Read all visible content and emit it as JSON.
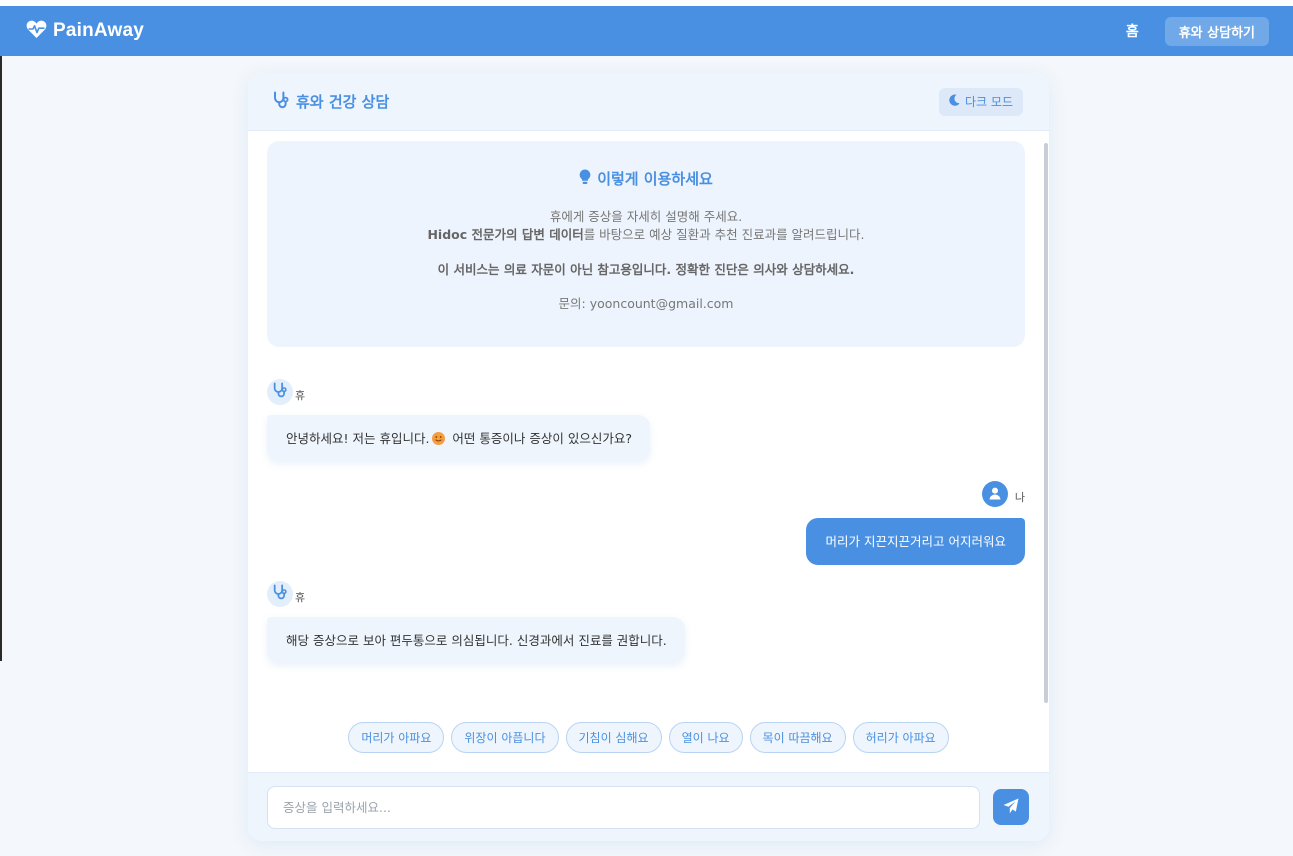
{
  "app": {
    "name": "PainAway",
    "brand_color": "#4a90e2"
  },
  "nav": {
    "home": "홈",
    "consult": "휴와 상담하기"
  },
  "chat": {
    "title": "휴와 건강 상담",
    "dark_mode_label": "다크 모드",
    "guide": {
      "title": "이렇게 이용하세요",
      "line1": "휴에게 증상을 자세히 설명해 주세요.",
      "line2_strong": "Hidoc 전문가의 답변 데이터",
      "line2_rest": "를 바탕으로 예상 질환과 추천 진료과를 알려드립니다.",
      "notice": "이 서비스는 의료 자문이 아닌 참고용입니다. 정확한 진단은 의사와 상담하세요.",
      "contact": "문의: yooncount@gmail.com"
    },
    "messages": [
      {
        "sender": "휴",
        "text_before": "안녕하세요! 저는 휴입니다.",
        "emoji": "smiling-face",
        "text_after": " 어떤 통증이나 증상이 있으신가요?"
      },
      {
        "sender": "나",
        "text": "머리가 지끈지끈거리고 어지러워요"
      },
      {
        "sender": "휴",
        "text": "해당 증상으로 보아 편두통으로 의심됩니다. 신경과에서 진료를 권합니다."
      }
    ],
    "quick_replies": [
      "머리가 아파요",
      "위장이 아픕니다",
      "기침이 심해요",
      "열이 나요",
      "목이 따끔해요",
      "허리가 아파요"
    ],
    "input": {
      "placeholder": "증상을 입력하세요...",
      "value": ""
    }
  },
  "icons": {
    "brand": "heart-pulse-icon",
    "header": "stethoscope-icon",
    "dark_mode": "moon-icon",
    "guide": "lightbulb-icon",
    "user": "user-icon",
    "send": "paper-plane-icon"
  }
}
